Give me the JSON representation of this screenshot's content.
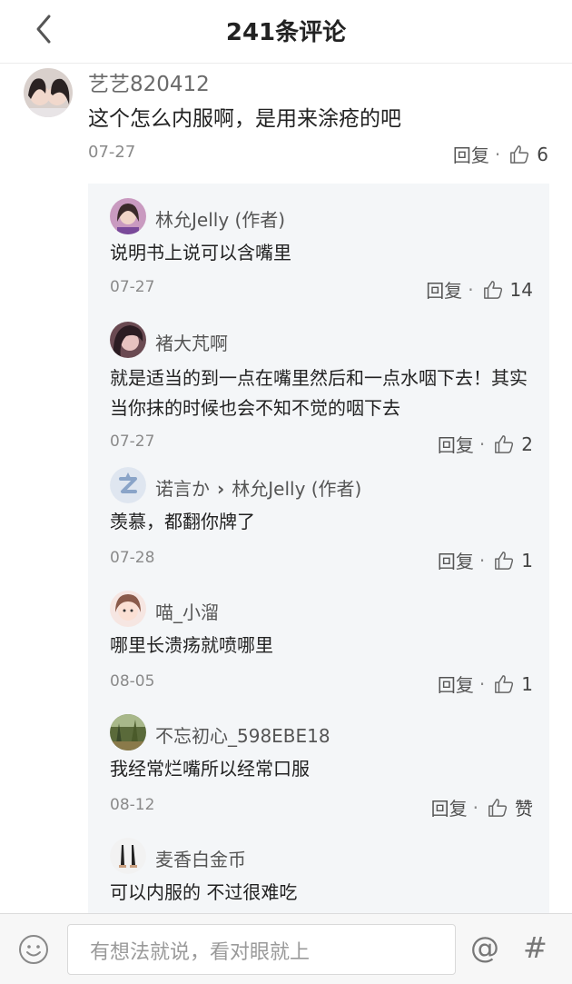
{
  "header": {
    "title": "241条评论",
    "back_icon": "chevron-left-icon"
  },
  "main_comment": {
    "user": "艺艺820412",
    "text": "这个怎么内服啊，是用来涂疮的吧",
    "date": "07-27",
    "reply_label": "回复",
    "like_count": "6"
  },
  "replies": [
    {
      "user": "林允Jelly (作者)",
      "text": "说明书上说可以含嘴里",
      "date": "07-27",
      "reply_label": "回复",
      "like_count": "14",
      "avatar_color": "#b07aa8"
    },
    {
      "user": "褚大芃啊",
      "text": "就是适当的到一点在嘴里然后和一点水咽下去！其实当你抹的时候也会不知不觉的咽下去",
      "date": "07-27",
      "reply_label": "回复",
      "like_count": "2",
      "avatar_color": "#c45a6a"
    },
    {
      "user": "诺言か",
      "reply_to": "林允Jelly (作者)",
      "text": "羡慕，都翻你牌了",
      "date": "07-28",
      "reply_label": "回复",
      "like_count": "1",
      "avatar_color": "#dfe6f0"
    },
    {
      "user": "喵_小溜",
      "text": "哪里长溃疡就喷哪里",
      "date": "08-05",
      "reply_label": "回复",
      "like_count": "1",
      "avatar_color": "#f2c8c8"
    },
    {
      "user": "不忘初心_598EBE18",
      "text": " 我经常烂嘴所以经常口服",
      "date": "08-12",
      "reply_label": "回复",
      "like_count": "赞",
      "avatar_color": "#7a8a5a"
    },
    {
      "user": "麦香白金币",
      "text": "可以内服的 不过很难吃",
      "avatar_color": "#eeeeee"
    }
  ],
  "footer": {
    "input_placeholder": "有想法就说，看对眼就上",
    "at_label": "@",
    "hash_label": "#",
    "emoji_icon": "smiley-icon"
  },
  "colors": {
    "reply_bg": "#f4f6f8",
    "date_gray": "#8a8a8a"
  }
}
